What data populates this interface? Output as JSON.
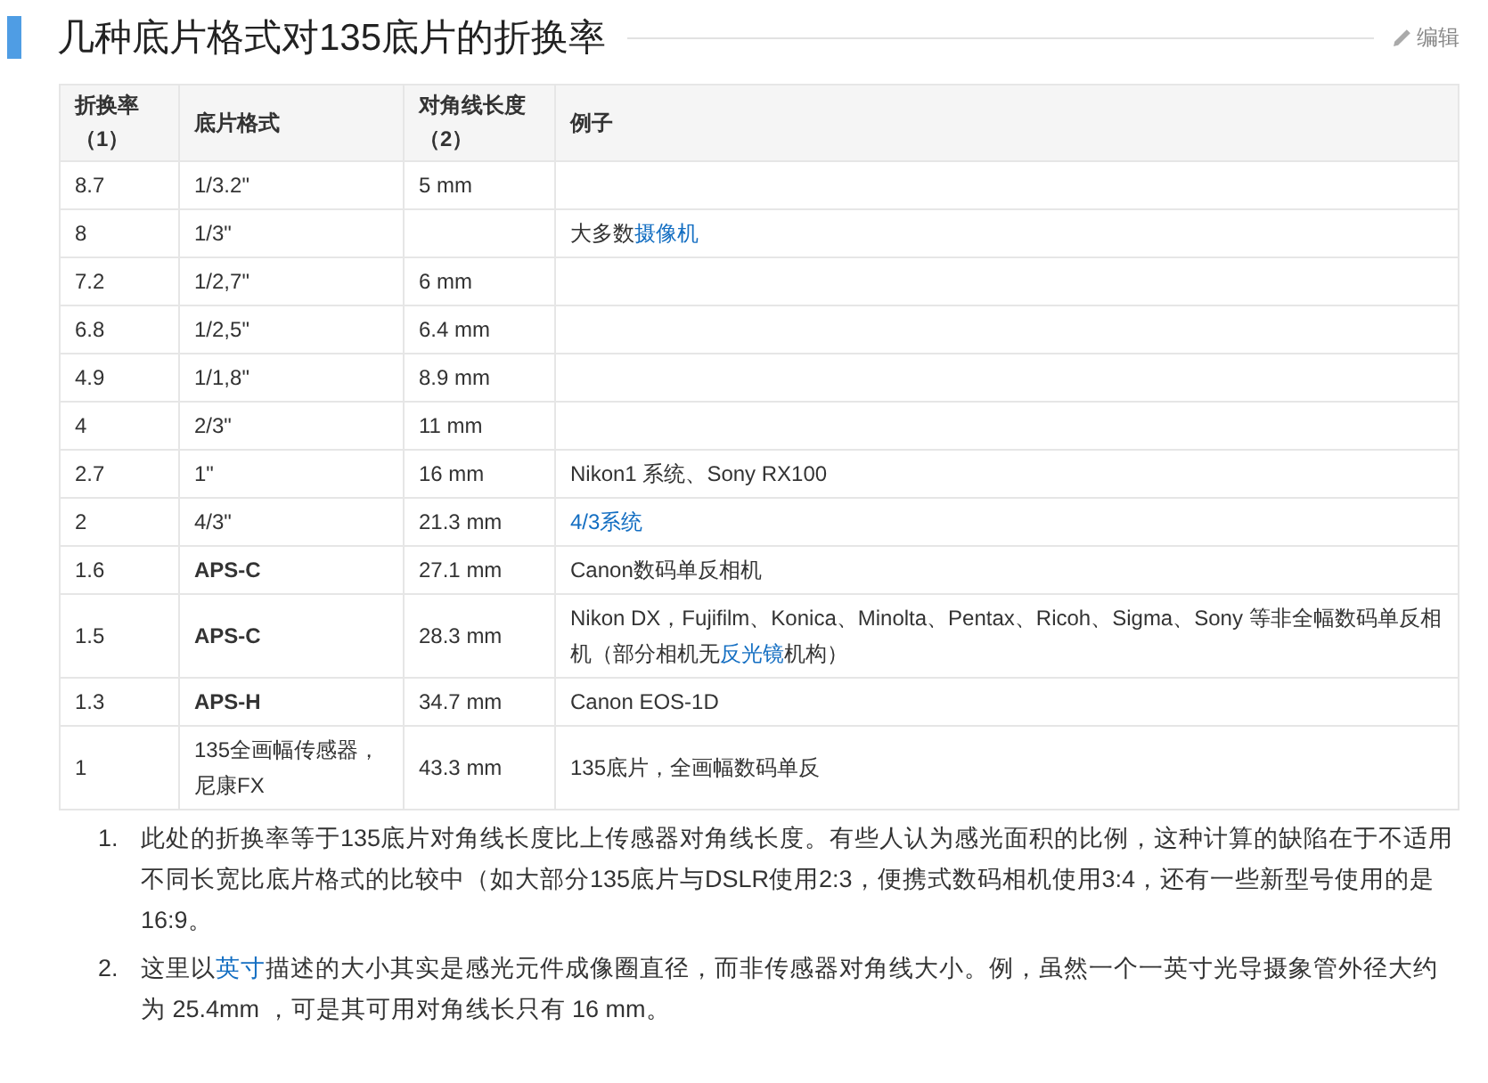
{
  "heading": {
    "title": "几种底片格式对135底片的折换率",
    "edit_label": "编辑"
  },
  "table": {
    "columns": [
      "折换率（1）",
      "底片格式",
      "对角线长度（2）",
      "例子"
    ],
    "rows": [
      {
        "ratio": "8.7",
        "format": "1/3.2\"",
        "format_bold": false,
        "diagonal": "5 mm",
        "example": []
      },
      {
        "ratio": "8",
        "format": "1/3\"",
        "format_bold": false,
        "example": [
          {
            "kind": "text",
            "text": "大多数"
          },
          {
            "kind": "link",
            "text": "摄像机"
          }
        ]
      },
      {
        "ratio": "7.2",
        "format": "1/2,7\"",
        "format_bold": false,
        "diagonal": "6 mm",
        "example": []
      },
      {
        "ratio": "6.8",
        "format": "1/2,5\"",
        "format_bold": false,
        "diagonal": "6.4 mm",
        "example": []
      },
      {
        "ratio": "4.9",
        "format": "1/1,8\"",
        "format_bold": false,
        "diagonal": "8.9 mm",
        "example": []
      },
      {
        "ratio": "4",
        "format": "2/3\"",
        "format_bold": false,
        "diagonal": "11 mm",
        "example": []
      },
      {
        "ratio": "2.7",
        "format": "1\"",
        "format_bold": false,
        "diagonal": "16 mm",
        "example": [
          {
            "kind": "text",
            "text": "Nikon1 系统、Sony RX100"
          }
        ]
      },
      {
        "ratio": "2",
        "format": "4/3\"",
        "format_bold": false,
        "diagonal": "21.3 mm",
        "example": [
          {
            "kind": "link",
            "text": "4/3系统"
          }
        ]
      },
      {
        "ratio": "1.6",
        "format": "APS-C",
        "format_bold": true,
        "diagonal": "27.1 mm",
        "example": [
          {
            "kind": "text",
            "text": "Canon数码单反相机"
          }
        ]
      },
      {
        "ratio": "1.5",
        "format": "APS-C",
        "format_bold": true,
        "diagonal": "28.3 mm",
        "example": [
          {
            "kind": "text",
            "text": "Nikon DX，Fujifilm、Konica、Minolta、Pentax、Ricoh、Sigma、Sony 等非全幅数码单反相机（部分相机无"
          },
          {
            "kind": "link",
            "text": "反光镜"
          },
          {
            "kind": "text",
            "text": "机构）"
          }
        ]
      },
      {
        "ratio": "1.3",
        "format": "APS-H",
        "format_bold": true,
        "diagonal": "34.7 mm",
        "example": [
          {
            "kind": "text",
            "text": "Canon EOS-1D"
          }
        ]
      },
      {
        "ratio": "1",
        "format": "135全画幅传感器，尼康FX",
        "format_bold": false,
        "diagonal": "43.3 mm",
        "example": [
          {
            "kind": "text",
            "text": "135底片，全画幅数码单反"
          }
        ]
      }
    ]
  },
  "notes": [
    {
      "number": "1.",
      "parts": [
        {
          "kind": "text",
          "text": "此处的折换率等于135底片对角线长度比上传感器对角线长度。有些人认为感光面积的比例，这种计算的缺陷在于不适用不同长宽比底片格式的比较中（如大部分135底片与DSLR使用2:3，便携式数码相机使用3:4，还有一些新型号使用的是16:9。"
        }
      ]
    },
    {
      "number": "2.",
      "parts": [
        {
          "kind": "text",
          "text": "这里以"
        },
        {
          "kind": "link",
          "text": "英寸"
        },
        {
          "kind": "text",
          "text": "描述的大小其实是感光元件成像圈直径，而非传感器对角线大小。例，虽然一个一英寸光导摄象管外径大约为 25.4mm ，可是其可用对角线长只有 16 mm。"
        }
      ]
    }
  ]
}
